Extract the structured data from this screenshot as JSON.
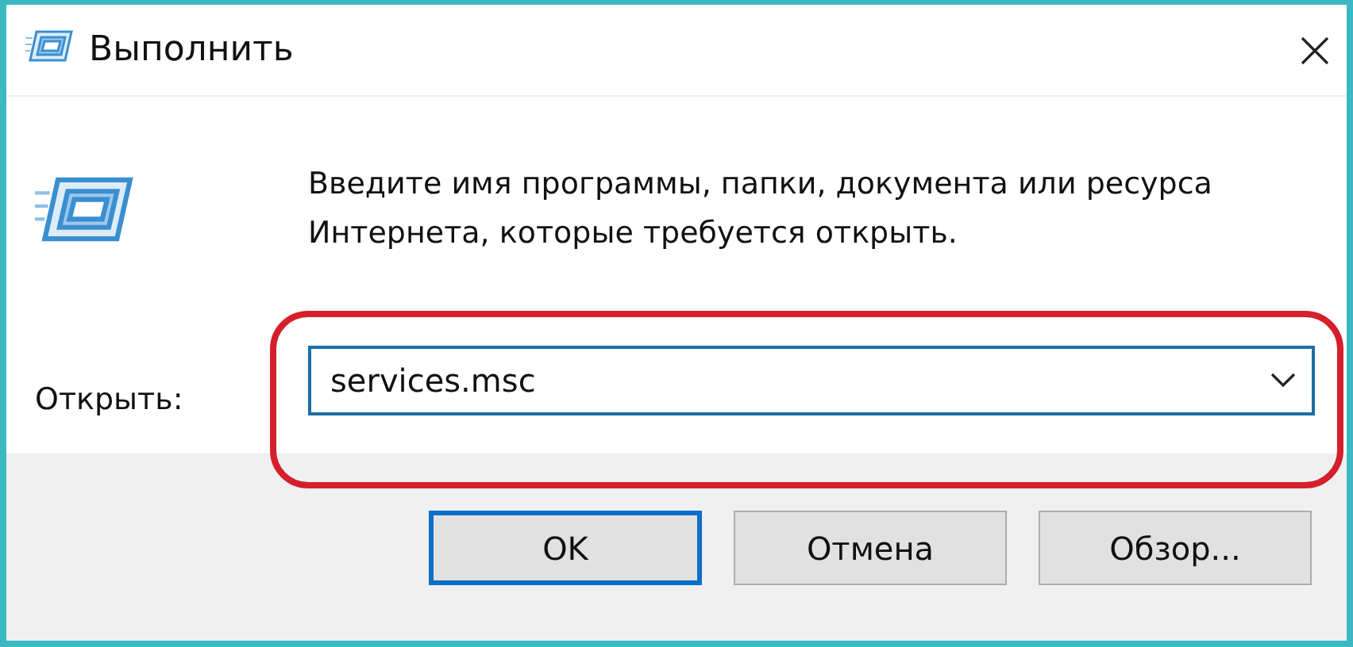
{
  "window": {
    "title": "Выполнить"
  },
  "prompt": "Введите имя программы, папки, документа или ресурса Интернета, которые требуется открыть.",
  "open_field": {
    "label": "Открыть:",
    "value": "services.msc",
    "highlighted": true
  },
  "buttons": [
    {
      "label": "OK",
      "default": true
    },
    {
      "label": "Отмена",
      "default": false
    },
    {
      "label": "Обзор...",
      "default": false
    }
  ]
}
